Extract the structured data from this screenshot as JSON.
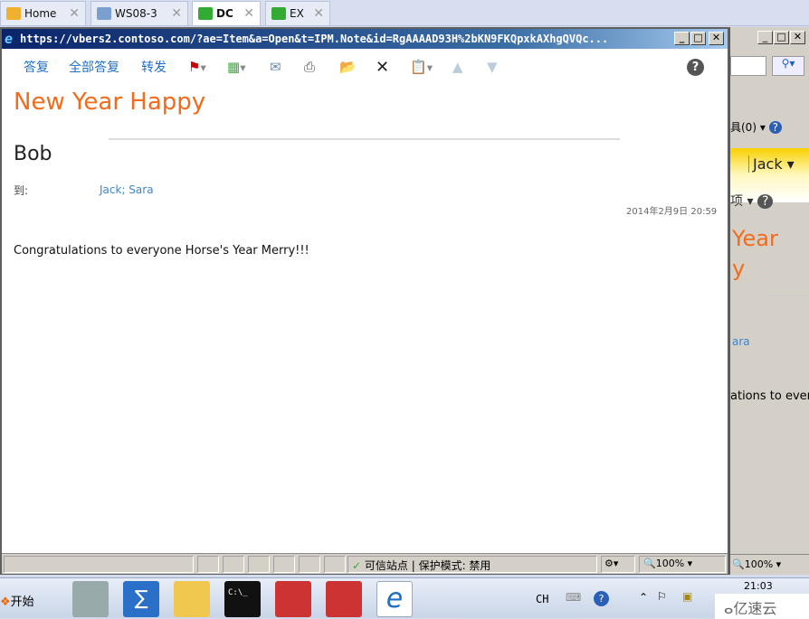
{
  "tabs": [
    {
      "label": "Home",
      "icon": "home-icon"
    },
    {
      "label": "WS08-3",
      "icon": "vm-paused-icon"
    },
    {
      "label": "DC",
      "icon": "vm-running-icon",
      "active": true
    },
    {
      "label": "EX",
      "icon": "vm-running-icon"
    }
  ],
  "popup": {
    "title": "https://vbers2.contoso.com/?ae=Item&a=Open&t=IPM.Note&id=RgAAAAD93H%2bKN9FKQpxkAXhgQVQc..."
  },
  "toolbar": {
    "reply": "答复",
    "reply_all": "全部答复",
    "forward": "转发"
  },
  "message": {
    "subject": "New Year Happy",
    "from": "Bob",
    "to_label": "到:",
    "to": "Jack; Sara",
    "date": "2014年2月9日  20:59",
    "body": "Congratulations to everyone Horse's Year Merry!!!"
  },
  "background_window": {
    "tools": "具(0)",
    "user": "Jack",
    "options": "项",
    "subject_fragment_1": "Year",
    "subject_fragment_2": "y",
    "to_fragment": "ara",
    "body_fragment": "ations to ever",
    "zoom": "100%"
  },
  "status": {
    "zone": "可信站点 | 保护模式: 禁用",
    "zoom": "100%"
  },
  "taskbar": {
    "start": "开始",
    "lang": "CH",
    "time": "21:03",
    "watermark": "亿速云"
  },
  "colors": {
    "subject": "#f26b1d",
    "link": "#3d86c8",
    "title_bar": "#0a246a"
  }
}
